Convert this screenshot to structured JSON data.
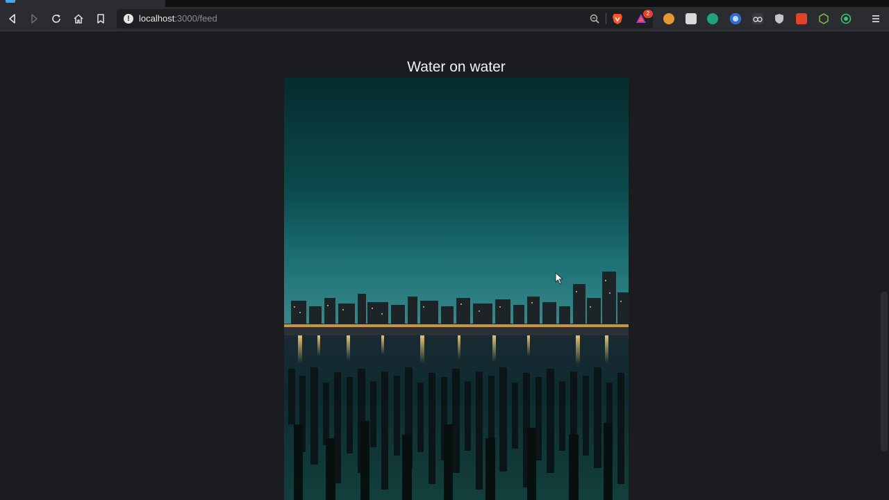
{
  "browser": {
    "url_host": "localhost",
    "url_path": ":3000/feed",
    "shields_badge": "2"
  },
  "post": {
    "title": "Water on water"
  },
  "icons": {
    "back": "back-icon",
    "forward": "forward-icon",
    "reload": "reload-icon",
    "home": "home-icon",
    "bookmark": "bookmark-icon",
    "site_info": "site-info-icon",
    "zoom": "zoom-icon",
    "brave": "brave-shields-icon",
    "rewards": "brave-rewards-icon",
    "menu": "hamburger-menu-icon"
  },
  "colors": {
    "page_background": "#1b1c1f",
    "toolbar": "#2b2c30",
    "brave_orange": "#fb542b"
  }
}
